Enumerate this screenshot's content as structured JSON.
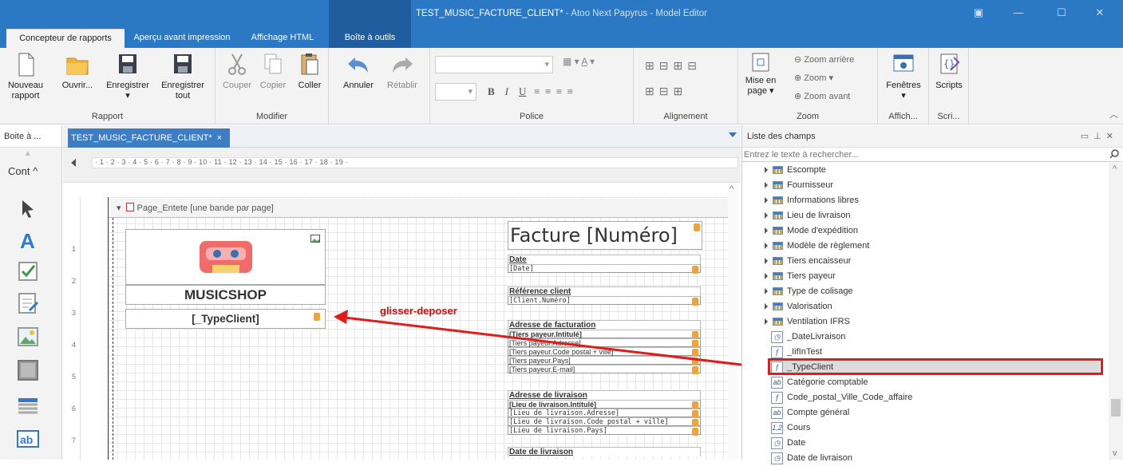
{
  "window": {
    "title_doc": "TEST_MUSIC_FACTURE_CLIENT*",
    "title_app": " - Atoo Next Papyrus - Model Editor"
  },
  "ribbon_tabs": [
    {
      "label": "Concepteur de rapports"
    },
    {
      "label": "Aperçu avant impression"
    },
    {
      "label": "Affichage HTML"
    },
    {
      "label": "Boîte à outils"
    }
  ],
  "ribbon": {
    "rapport": {
      "nouveau": "Nouveau rapport",
      "ouvrir": "Ouvrir...",
      "enregistrer": "Enregistrer",
      "enregistrer_tout": "Enregistrer tout",
      "label": "Rapport"
    },
    "modifier": {
      "couper": "Couper",
      "copier": "Copier",
      "coller": "Coller",
      "label": "Modifier"
    },
    "historique": {
      "annuler": "Annuler",
      "retablir": "Rétablir"
    },
    "police": {
      "label": "Police",
      "bold": "B",
      "italic": "I",
      "underline": "U"
    },
    "alignement": {
      "label": "Alignement"
    },
    "zoom": {
      "mise_en_page": "Mise en page",
      "zoom_arriere": "Zoom arrière",
      "zoom": "Zoom",
      "zoom_avant": "Zoom avant",
      "label": "Zoom"
    },
    "affich": {
      "fenetres": "Fenêtres",
      "label": "Affich..."
    },
    "scripts": {
      "scripts": "Scripts",
      "label": "Scri..."
    }
  },
  "left_panel": {
    "title": "Boite à ...",
    "section": "Cont"
  },
  "doc_tab": {
    "label": "TEST_MUSIC_FACTURE_CLIENT*",
    "close": "×"
  },
  "ruler": {
    "numbers": "· 1 · 2 · 3 · 4 · 5 · 6 · 7 · 8 · 9 · 10 · 11 · 12 · 13 · 14 · 15 · 16 · 17 · 18 · 19 ·"
  },
  "vruler": [
    "1",
    "2",
    "3",
    "4",
    "5",
    "6",
    "7"
  ],
  "band": {
    "label": "Page_Entete [une bande par page]"
  },
  "report": {
    "brand": "MUSICSHOP",
    "typeclient": "[_TypeClient]",
    "facture": "Facture [Numéro]",
    "date_label": "Date",
    "date_value": "[Date]",
    "ref_label": "Référence client",
    "ref_value": "[Client.Numéro]",
    "adr_fact_label": "Adresse de facturation",
    "adr_fact_rows": [
      "[Tiers payeur.Intitulé]",
      "[Tiers payeur.Adresse]",
      "[Tiers payeur.Code postal + ville]",
      "[Tiers payeur.Pays]",
      "[Tiers payeur.E-mail]"
    ],
    "adr_liv_label": "Adresse de livraison",
    "adr_liv_rows": [
      "[Lieu de livraison.Intitulé]",
      "[Lieu de livraison.Adresse]",
      "[Lieu de livraison.Code postal + ville]",
      "[Lieu de livraison.Pays]"
    ],
    "date_liv_label": "Date de livraison"
  },
  "annotation": {
    "text": "glisser-deposer",
    "color": "#e00000"
  },
  "field_list": {
    "title": "Liste des champs",
    "search_placeholder": "Entrez le texte à rechercher...",
    "items": [
      {
        "label": "Escompte",
        "kind": "table"
      },
      {
        "label": "Fournisseur",
        "kind": "table"
      },
      {
        "label": "Informations libres",
        "kind": "table"
      },
      {
        "label": "Lieu de livraison",
        "kind": "table"
      },
      {
        "label": "Mode d'expédition",
        "kind": "table"
      },
      {
        "label": "Modèle de règlement",
        "kind": "table"
      },
      {
        "label": "Tiers encaisseur",
        "kind": "table"
      },
      {
        "label": "Tiers payeur",
        "kind": "table"
      },
      {
        "label": "Type de colisage",
        "kind": "table"
      },
      {
        "label": "Valorisation",
        "kind": "table"
      },
      {
        "label": "Ventilation IFRS",
        "kind": "table"
      },
      {
        "label": "_DateLivraison",
        "kind": "date"
      },
      {
        "label": "_IifInTest",
        "kind": "func"
      },
      {
        "label": "_TypeClient",
        "kind": "func",
        "selected": true
      },
      {
        "label": "Catégorie comptable",
        "kind": "text"
      },
      {
        "label": "Code_postal_Ville_Code_affaire",
        "kind": "func"
      },
      {
        "label": "Compte général",
        "kind": "text"
      },
      {
        "label": "Cours",
        "kind": "num"
      },
      {
        "label": "Date",
        "kind": "date"
      },
      {
        "label": "Date de livraison",
        "kind": "date"
      }
    ]
  },
  "colors": {
    "title_bar": "#2b78c4",
    "tab_active_doc": "#3c7dc4",
    "highlight": "#e21b1b",
    "field_badge": "#f2a338"
  }
}
